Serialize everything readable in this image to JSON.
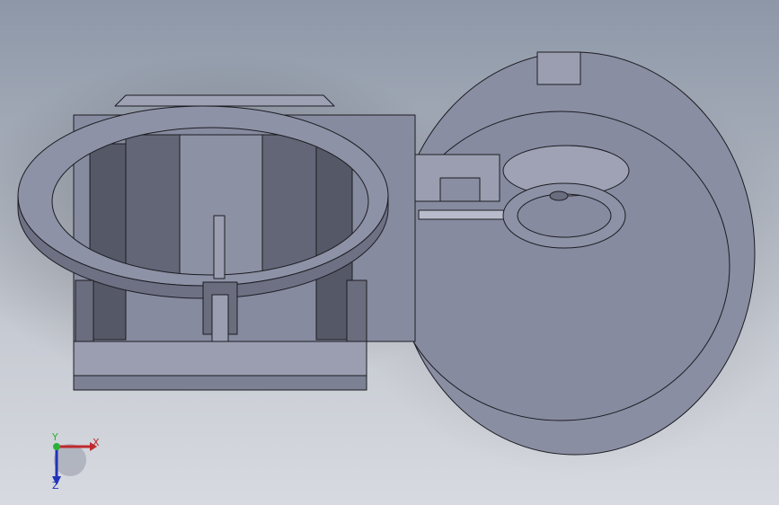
{
  "viewport": {
    "background_top": "#8d97a8",
    "background_bottom": "#d7dae0"
  },
  "model": {
    "face_color": "#8a8ea2",
    "face_light": "#a3a7b9",
    "face_dark": "#555866",
    "edge_color": "#1c1c22"
  },
  "triad": {
    "x_label": "X",
    "y_label": "Y",
    "z_label": "Z",
    "x_color": "#c0282d",
    "y_color": "#2bb13a",
    "z_color": "#2233b8"
  }
}
